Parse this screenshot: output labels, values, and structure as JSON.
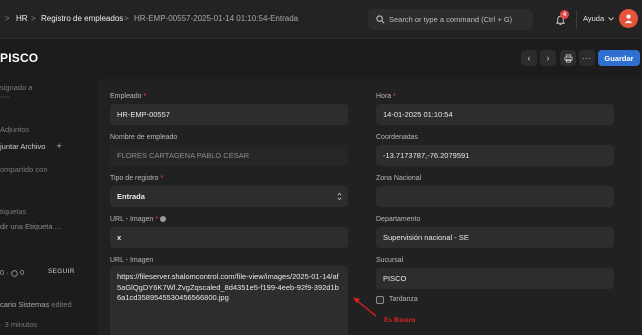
{
  "navbar": {
    "breadcrumb": [
      "HR",
      "Registro de empleados",
      "HR-EMP-00557-2025-01-14 01:10:54-Entrada"
    ],
    "search_placeholder": "Search or type a command (Ctrl + G)",
    "notification_count": "4",
    "help_label": "Ayuda"
  },
  "page": {
    "title": "PISCO",
    "save_label": "Guardar"
  },
  "sidebar": {
    "assigned": "signado a",
    "attachments": "Adjuntos",
    "attach_file": "juntar Archivo",
    "shared": "ompartido con",
    "tags": "tiquetas",
    "add_tag": "dir una Etiqueta ...",
    "likes": "0",
    "comments": "0",
    "follow": "SEGUIR",
    "edited_by": "cario Sistemas",
    "edited_suffix": "edited",
    "edited_time": "3 minutos"
  },
  "form": {
    "empleado": {
      "label": "Empleado",
      "value": "HR-EMP-00557"
    },
    "nombre": {
      "label": "Nombre de empleado",
      "value": "FLORES CARTAGENA PABLO CESAR"
    },
    "tipo": {
      "label": "Tipo de registro",
      "value": "Entrada"
    },
    "url_imagen_short": {
      "label": "URL - Imagen",
      "value": "x"
    },
    "url_imagen": {
      "label": "URL - Imagen",
      "value": "https://fileserver.shalomcontrol.com/file-view/images/2025-01-14/af5aGlQgDY6K7Wl.ZvgZqscaled_8d4351e5-f199-4eeb-92f9-392d1b6a1cd3589545530456566800.jpg"
    },
    "hora": {
      "label": "Hora",
      "value": "14-01-2025 01:10:54"
    },
    "coordenadas": {
      "label": "Coordenadas",
      "value": "-13.7173787,-76.2079591"
    },
    "zona": {
      "label": "Zona Nacional",
      "value": ""
    },
    "departamento": {
      "label": "Departamento",
      "value": "Supervisión nacional  - SE"
    },
    "sucursal": {
      "label": "Sucursal",
      "value": "PISCO"
    },
    "tardanza": {
      "label": "Tardanza",
      "checked": false
    }
  },
  "annotation": {
    "text": "Es Rostro",
    "color": "#e02020"
  },
  "colors": {
    "accent": "#2f6fd0",
    "badge": "#e04848",
    "avatar": "#e5533d"
  }
}
